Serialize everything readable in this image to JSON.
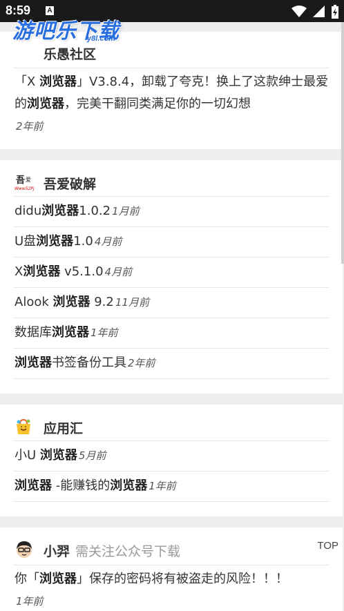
{
  "status": {
    "time": "8:59",
    "badge": "A"
  },
  "watermark": {
    "main": "游吧乐下载",
    "sub": "y8l.com"
  },
  "cards": [
    {
      "title": "乐愚社区",
      "rows": [
        {
          "pre": "「X ",
          "bold": "浏览器",
          "post": "」V3.8.4，卸载了夸克！换上了这款绅士最爱的",
          "bold2": "浏览器",
          "post2": "，完美干翻同类满足你的一切幻想",
          "time": "2年前"
        }
      ]
    },
    {
      "title": "吾爱破解",
      "rows": [
        {
          "pre": "didu",
          "bold": "浏览器",
          "post": "1.0.2",
          "time": "1月前"
        },
        {
          "pre": "U盘",
          "bold": "浏览器",
          "post": "1.0",
          "time": "4月前"
        },
        {
          "pre": "X",
          "bold": "浏览器",
          "post": " v5.1.0",
          "time": "4月前"
        },
        {
          "pre": "Alook ",
          "bold": "浏览器",
          "post": " 9.2",
          "time": "11月前"
        },
        {
          "pre": "数据库",
          "bold": "浏览器",
          "post": "",
          "time": "1年前"
        },
        {
          "pre": "",
          "bold": "浏览器",
          "post": "书签备份工具",
          "time": "2年前"
        }
      ]
    },
    {
      "title": "应用汇",
      "rows": [
        {
          "pre": "小U ",
          "bold": "浏览器",
          "post": "",
          "time": "5月前"
        },
        {
          "pre": "",
          "bold": "浏览器",
          "post": " -能赚钱的",
          "bold2": "浏览器",
          "time": "1年前"
        }
      ]
    },
    {
      "title": "小羿",
      "note": "需关注公众号下载",
      "rows": [
        {
          "pre": "你「",
          "bold": "浏览器",
          "post": "」保存的密码将有被盗走的风险！！！",
          "time": "1年前"
        }
      ]
    }
  ],
  "top_button": "TOP",
  "colors": {
    "accent": "#2a6fe0",
    "background": "#eeeeee",
    "card": "#ffffff"
  }
}
